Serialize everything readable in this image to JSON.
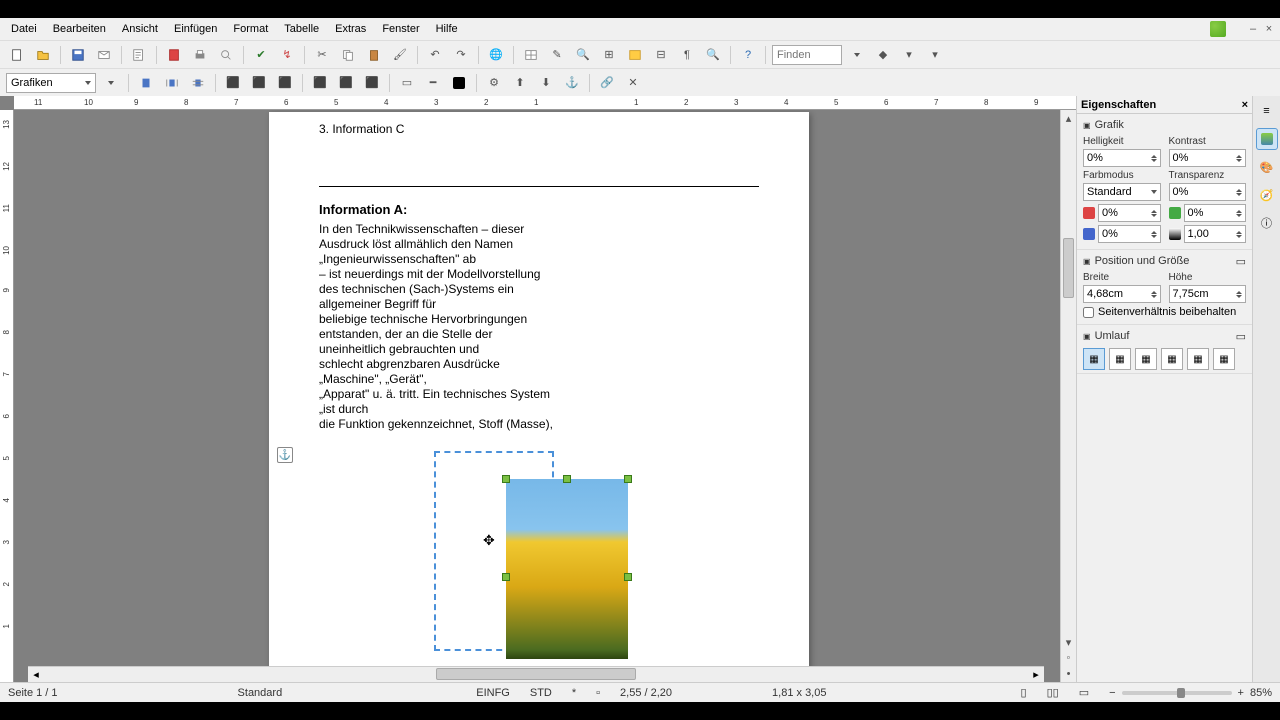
{
  "menu": {
    "items": [
      "Datei",
      "Bearbeiten",
      "Ansicht",
      "Einfügen",
      "Format",
      "Tabelle",
      "Extras",
      "Fenster",
      "Hilfe"
    ]
  },
  "toolbar": {
    "object_select": "Grafiken",
    "find_placeholder": "Finden"
  },
  "ruler_h": [
    "11",
    "10",
    "9",
    "8",
    "7",
    "6",
    "5",
    "4",
    "3",
    "2",
    "1",
    "",
    "1",
    "2",
    "3",
    "4",
    "5",
    "6",
    "7",
    "8",
    "9"
  ],
  "ruler_v": [
    "13",
    "12",
    "11",
    "10",
    "9",
    "8",
    "7",
    "6",
    "5",
    "4",
    "3",
    "2",
    "1"
  ],
  "document": {
    "list_item": "3. Information C",
    "heading": "Information A:",
    "body": "In den Technikwissenschaften – dieser\nAusdruck löst allmählich den Namen\n„Ingenieurwissenschaften\" ab\n– ist neuerdings mit der Modellvorstellung\ndes technischen (Sach-)Systems ein\nallgemeiner Begriff für\nbeliebige technische Hervorbringungen\nentstanden, der an die Stelle der\nuneinheitlich gebrauchten und\nschlecht abgrenzbaren Ausdrücke\n„Maschine\", „Gerät\",\n„Apparat\" u. ä. tritt. Ein technisches System\n„ist durch\ndie Funktion gekennzeichnet, Stoff (Masse),"
  },
  "properties": {
    "title": "Eigenschaften",
    "sections": {
      "grafik": {
        "label": "Grafik",
        "brightness_label": "Helligkeit",
        "brightness": "0%",
        "contrast_label": "Kontrast",
        "contrast": "0%",
        "colormode_label": "Farbmodus",
        "colormode": "Standard",
        "transparency_label": "Transparenz",
        "transparency": "0%",
        "red": "0%",
        "green": "0%",
        "blue": "0%",
        "gamma": "1,00"
      },
      "posgroesse": {
        "label": "Position und Größe",
        "width_label": "Breite",
        "width": "4,68cm",
        "height_label": "Höhe",
        "height": "7,75cm",
        "keep_ratio": "Seitenverhältnis beibehalten"
      },
      "umlauf": {
        "label": "Umlauf"
      }
    }
  },
  "status": {
    "page": "Seite 1 / 1",
    "style": "Standard",
    "insert": "EINFG",
    "std": "STD",
    "cursor": "2,55 / 2,20",
    "size": "1,81 x 3,05",
    "zoom": "85%"
  }
}
